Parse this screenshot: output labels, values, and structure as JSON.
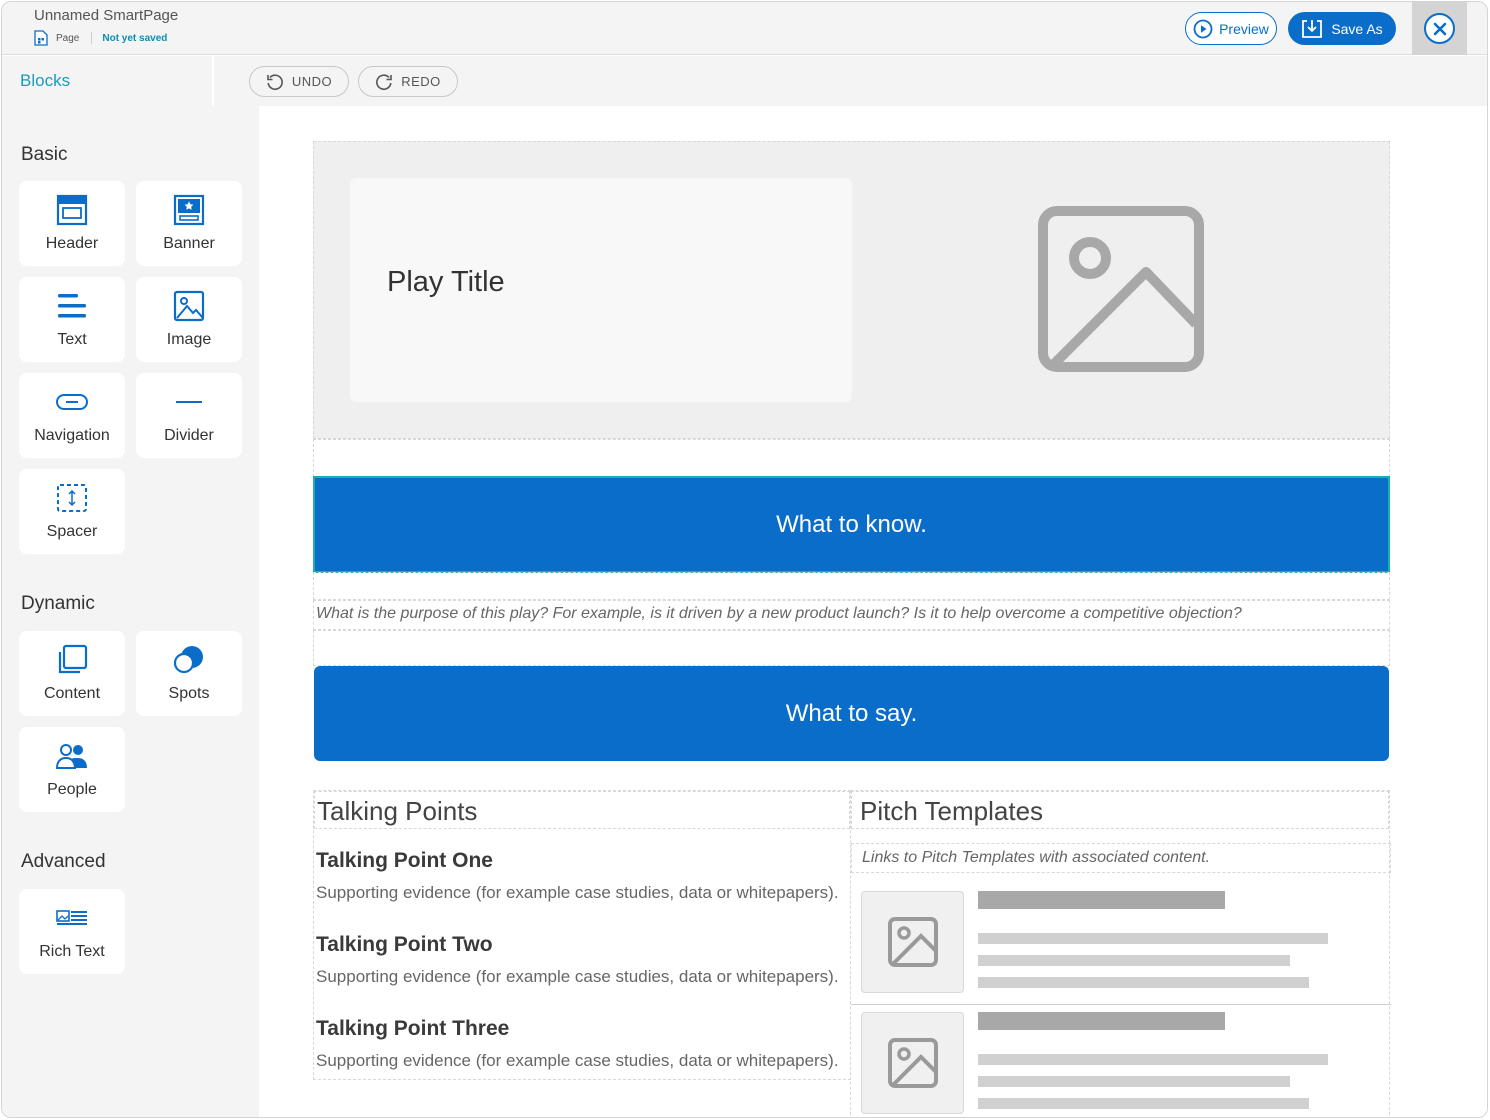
{
  "header": {
    "title": "Unnamed SmartPage",
    "page_label": "Page",
    "save_status": "Not yet saved",
    "preview_label": "Preview",
    "save_as_label": "Save As"
  },
  "toolbar": {
    "blocks_tab": "Blocks",
    "undo_label": "UNDO",
    "redo_label": "REDO"
  },
  "sidebar": {
    "basic_title": "Basic",
    "basic_blocks": [
      "Header",
      "Banner",
      "Text",
      "Image",
      "Navigation",
      "Divider",
      "Spacer"
    ],
    "dynamic_title": "Dynamic",
    "dynamic_blocks": [
      "Content",
      "Spots",
      "People"
    ],
    "advanced_title": "Advanced",
    "advanced_blocks": [
      "Rich Text"
    ]
  },
  "canvas": {
    "hero_title": "Play Title",
    "banner_know": "What to know.",
    "purpose_text": "What is the purpose of this play? For example, is it driven by a new product launch? Is it to help overcome a competitive objection?",
    "banner_say": "What to say.",
    "talking_points_title": "Talking Points",
    "talking_points": [
      {
        "title": "Talking Point One",
        "desc": "Supporting evidence (for example case studies, data or whitepapers)."
      },
      {
        "title": "Talking Point Two",
        "desc": "Supporting evidence (for example case studies, data or whitepapers)."
      },
      {
        "title": "Talking Point Three",
        "desc": "Supporting evidence (for example case studies, data or whitepapers)."
      }
    ],
    "pitch_title": "Pitch Templates",
    "pitch_desc": "Links to Pitch Templates with associated content."
  },
  "colors": {
    "accent": "#0a6dc9",
    "teal": "#1b9abc",
    "selection": "#18b3a8"
  }
}
